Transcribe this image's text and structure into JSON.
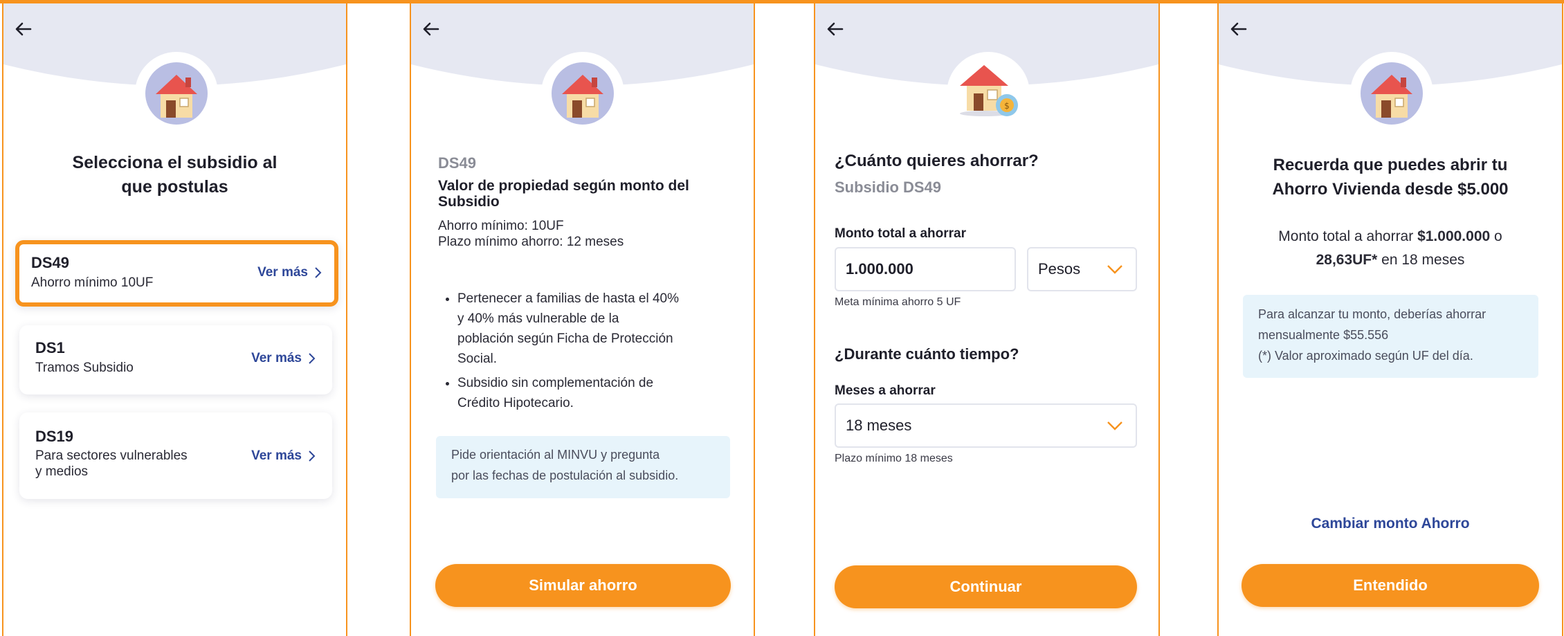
{
  "colors": {
    "accent": "#f7931e",
    "header_bg": "#e6e8f2",
    "link": "#2e4799",
    "info_bg": "#e7f4fb"
  },
  "icons": {
    "back": "arrow-left-icon",
    "house": "house-icon",
    "chevron": "chevron-right-icon",
    "dropdown": "chevron-down-icon",
    "coin": "coin-icon"
  },
  "screen1": {
    "title_line1": "Selecciona el subsidio al",
    "title_line2": "que postulas",
    "cards": [
      {
        "code": "DS49",
        "desc_line1": "Ahorro mínimo 10UF",
        "desc_line2": "",
        "link": "Ver más"
      },
      {
        "code": "DS1",
        "desc_line1": "Tramos Subsidio",
        "desc_line2": "",
        "link": "Ver más"
      },
      {
        "code": "DS19",
        "desc_line1": "Para sectores vulnerables",
        "desc_line2": "y medios",
        "link": "Ver más"
      }
    ]
  },
  "screen2": {
    "code": "DS49",
    "heading_line1": "Valor de propiedad según monto del",
    "heading_line2": "Subsidio",
    "min_savings": "Ahorro mínimo: 10UF",
    "min_term": "Plazo mínimo ahorro: 12 meses",
    "bullet1_line1": "Pertenecer a familias de hasta el 40%",
    "bullet1_line2": "y 40% más vulnerable de la",
    "bullet1_line3": "población según Ficha de Protección",
    "bullet1_line4": "Social.",
    "bullet2_line1": "Subsidio sin complementación de",
    "bullet2_line2": "Crédito Hipotecario.",
    "info_line1": "Pide orientación al MINVU y pregunta",
    "info_line2": "por las fechas de postulación al subsidio.",
    "button": "Simular ahorro"
  },
  "screen3": {
    "title": "¿Cuánto quieres ahorrar?",
    "subtitle": "Subsidio DS49",
    "amount_label": "Monto total a ahorrar",
    "amount_value": "1.000.000",
    "currency_selected": "Pesos",
    "amount_hint": "Meta mínima ahorro 5 UF",
    "duration_title": "¿Durante cuánto tiempo?",
    "months_label": "Meses a ahorrar",
    "months_selected": "18 meses",
    "months_hint": "Plazo mínimo 18 meses",
    "button": "Continuar"
  },
  "screen4": {
    "title_line1": "Recuerda que puedes abrir tu",
    "title_line2": "Ahorro Vivienda desde $5.000",
    "summary_pre": "Monto total a ahorrar ",
    "summary_amount": "$1.000.000",
    "summary_or": " o",
    "summary_uf": "28,63UF*",
    "summary_post": " en 18 meses",
    "info_line1": "Para alcanzar tu monto, deberías ahorrar",
    "info_line2": "mensualmente $55.556",
    "info_line3": "(*) Valor aproximado según UF del día.",
    "change_link": "Cambiar monto Ahorro",
    "button": "Entendido"
  }
}
